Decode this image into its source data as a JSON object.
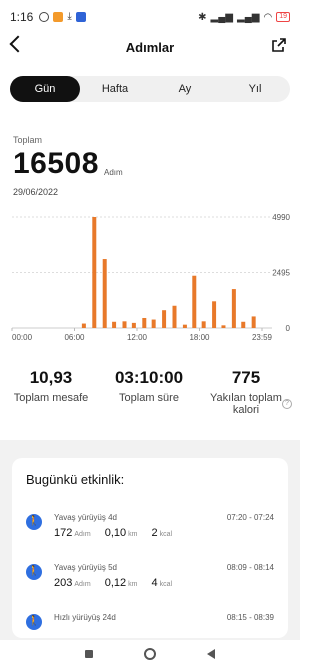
{
  "status": {
    "time": "1:16",
    "battery": "19",
    "network": "4G"
  },
  "header": {
    "title": "Adımlar"
  },
  "tabs": [
    {
      "label": "Gün",
      "active": true
    },
    {
      "label": "Hafta",
      "active": false
    },
    {
      "label": "Ay",
      "active": false
    },
    {
      "label": "Yıl",
      "active": false
    }
  ],
  "summary": {
    "total_label": "Toplam",
    "steps": "16508",
    "steps_unit": "Adım",
    "date": "29/06/2022"
  },
  "chart_data": {
    "type": "bar",
    "bar_color": "#e8792a",
    "y_ticks": [
      "4990",
      "2495",
      "0"
    ],
    "x_ticks": [
      "00:00",
      "06:00",
      "12:00",
      "18:00",
      "23:59"
    ],
    "ylim": [
      0,
      4990
    ],
    "grid": "dashed",
    "bars": [
      {
        "x": 6.9,
        "value": 200
      },
      {
        "x": 7.9,
        "value": 4990
      },
      {
        "x": 8.9,
        "value": 3100
      },
      {
        "x": 9.8,
        "value": 280
      },
      {
        "x": 10.8,
        "value": 300
      },
      {
        "x": 11.7,
        "value": 230
      },
      {
        "x": 12.7,
        "value": 450
      },
      {
        "x": 13.6,
        "value": 380
      },
      {
        "x": 14.6,
        "value": 800
      },
      {
        "x": 15.6,
        "value": 1000
      },
      {
        "x": 16.6,
        "value": 150
      },
      {
        "x": 17.5,
        "value": 2350
      },
      {
        "x": 18.4,
        "value": 300
      },
      {
        "x": 19.4,
        "value": 1200
      },
      {
        "x": 20.3,
        "value": 120
      },
      {
        "x": 21.3,
        "value": 1750
      },
      {
        "x": 22.2,
        "value": 280
      },
      {
        "x": 23.2,
        "value": 520
      }
    ]
  },
  "stats": [
    {
      "value": "10,93",
      "label": "Toplam mesafe"
    },
    {
      "value": "03:10:00",
      "label": "Toplam süre"
    },
    {
      "value": "775",
      "label": "Yakılan toplam kalori"
    }
  ],
  "activity": {
    "title": "Bugünkü etkinlik:",
    "items": [
      {
        "name": "Yavaş yürüyüş 4d",
        "time": "07:20 - 07:24",
        "steps": "172",
        "steps_unit": "Adım",
        "dist": "0,10",
        "dist_unit": "km",
        "cal": "2",
        "cal_unit": "kcal"
      },
      {
        "name": "Yavaş yürüyüş 5d",
        "time": "08:09 - 08:14",
        "steps": "203",
        "steps_unit": "Adım",
        "dist": "0,12",
        "dist_unit": "km",
        "cal": "4",
        "cal_unit": "kcal"
      },
      {
        "name": "Hızlı yürüyüş 24d",
        "time": "08:15 - 08:39"
      }
    ]
  }
}
